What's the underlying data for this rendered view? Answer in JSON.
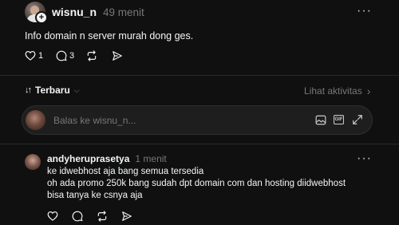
{
  "post": {
    "username": "wisnu_n",
    "time": "49 menit",
    "text": "Info domain n server murah dong ges.",
    "likes": "1",
    "comments": "3",
    "plus_badge": "+"
  },
  "replies_bar": {
    "sort_icon": "↓↑",
    "sort_label": "Terbaru",
    "sort_caret": "⌵",
    "activity_label": "Lihat aktivitas",
    "activity_chevron": "›"
  },
  "reply_composer": {
    "placeholder": "Balas ke wisnu_n...",
    "gif_label": "GIF"
  },
  "reply": {
    "username": "andyheruprasetya",
    "time": "1 menit",
    "lines": [
      "ke idwebhost aja bang semua tersedia",
      "oh ada promo 250k bang sudah dpt domain com dan hosting diidwebhost",
      "bisa tanya ke csnya aja"
    ]
  },
  "more_glyph": "···"
}
